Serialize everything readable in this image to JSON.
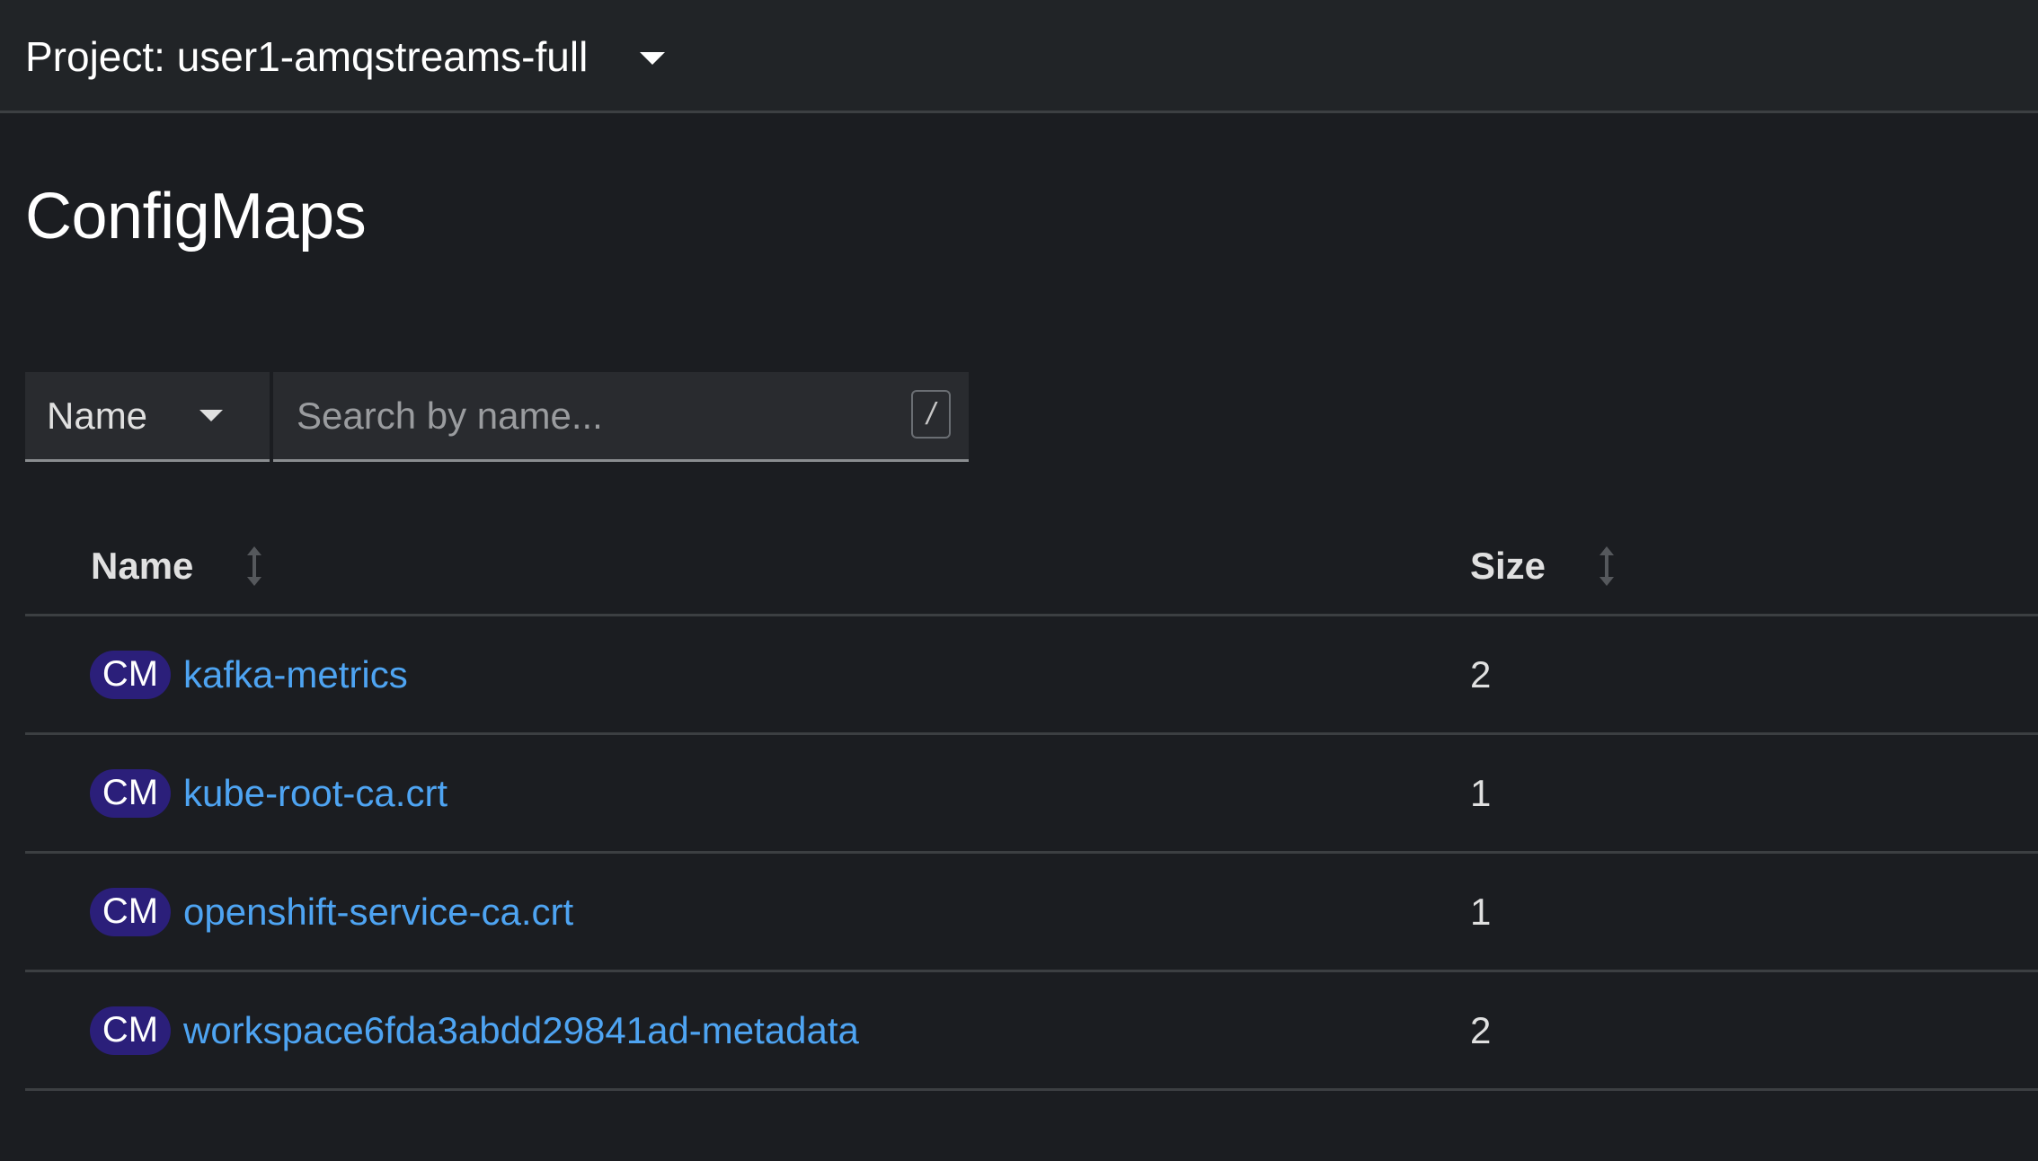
{
  "header": {
    "project_label": "Project: user1-amqstreams-full"
  },
  "page": {
    "title": "ConfigMaps"
  },
  "filter": {
    "type_selected": "Name",
    "search_placeholder": "Search by name...",
    "search_value": "",
    "shortcut_hint": "/"
  },
  "table": {
    "columns": [
      {
        "label": "Name",
        "sortable": true
      },
      {
        "label": "Size",
        "sortable": true
      }
    ],
    "rows": [
      {
        "badge": "CM",
        "name": "kafka-metrics",
        "size": "2"
      },
      {
        "badge": "CM",
        "name": "kube-root-ca.crt",
        "size": "1"
      },
      {
        "badge": "CM",
        "name": "openshift-service-ca.crt",
        "size": "1"
      },
      {
        "badge": "CM",
        "name": "workspace6fda3abdd29841ad-metadata",
        "size": "2"
      }
    ]
  },
  "icons": {
    "project_dropdown": "caret-down-icon",
    "filter_dropdown": "caret-down-icon",
    "sort": "sort-icon"
  },
  "colors": {
    "background": "#1b1d21",
    "topbar": "#212427",
    "link": "#4ea4f2",
    "badge": "#2b1f7a",
    "divider": "#3c3f42"
  }
}
